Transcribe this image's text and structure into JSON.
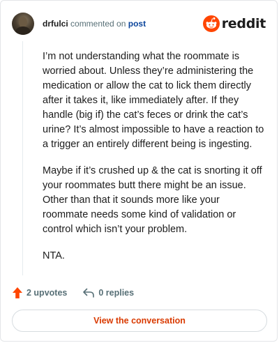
{
  "header": {
    "author": "drfulci",
    "action_text": "commented on",
    "post_link": "post",
    "brand": "reddit"
  },
  "comment": {
    "paragraphs": [
      "I’m not understanding what the roommate is worried about. Unless they’re administering the medication or allow the cat to lick them directly after it takes it, like immediately after. If they handle (big if) the cat’s feces or drink the cat’s urine? It’s almost impossible to have a reaction to a trigger an entirely different being is ingesting.",
      "Maybe if it’s crushed up & the cat is snorting it off your roommates butt there might be an issue. Other than that it sounds more like your roommate needs some kind of validation or control which isn’t your problem.",
      "NTA."
    ]
  },
  "actions": {
    "upvotes": "2 upvotes",
    "replies": "0 replies"
  },
  "cta": {
    "label": "View the conversation"
  },
  "colors": {
    "brand_orange": "#ff4500",
    "link_blue": "#0a449b",
    "cta_text": "#d93a00",
    "muted": "#576f76"
  },
  "icons": {
    "brand": "reddit-snoo-icon",
    "upvote": "upvote-arrow-icon",
    "reply": "reply-arrow-icon"
  }
}
